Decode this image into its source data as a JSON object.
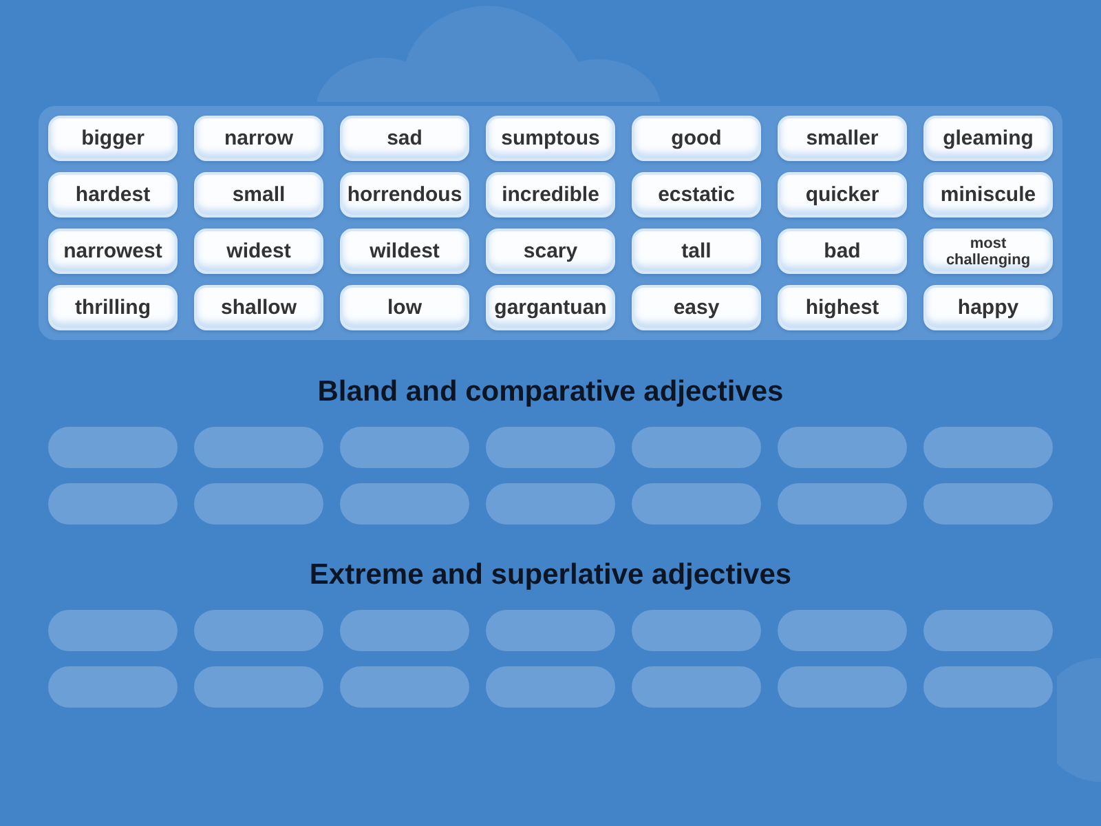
{
  "word_bank": {
    "cards": [
      "bigger",
      "narrow",
      "sad",
      "sumptous",
      "good",
      "smaller",
      "gleaming",
      "hardest",
      "small",
      "horrendous",
      "incredible",
      "ecstatic",
      "quicker",
      "miniscule",
      "narrowest",
      "widest",
      "wildest",
      "scary",
      "tall",
      "bad",
      "most challenging",
      "thrilling",
      "shallow",
      "low",
      "gargantuan",
      "easy",
      "highest",
      "happy"
    ]
  },
  "groups": [
    {
      "title": "Bland and comparative adjectives"
    },
    {
      "title": "Extreme and superlative adjectives"
    }
  ]
}
